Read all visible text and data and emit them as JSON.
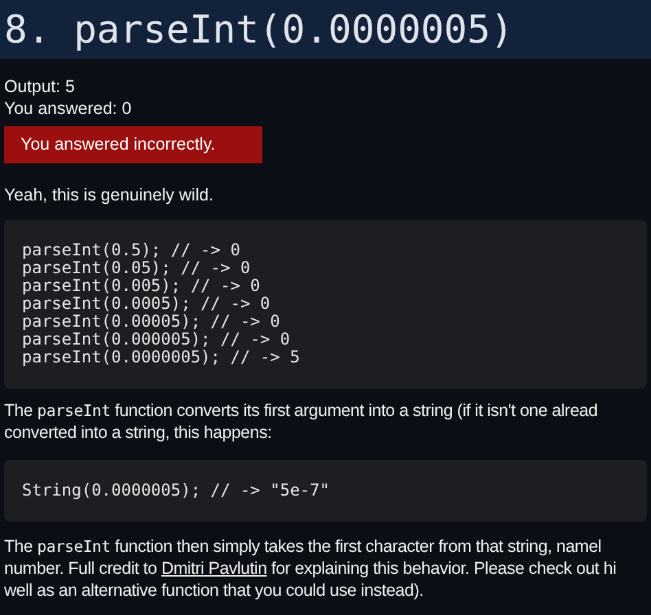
{
  "title": "8. parseInt(0.0000005)",
  "result": {
    "output": "Output: 5",
    "answered": "You answered: 0",
    "verdict": "You answered incorrectly.",
    "correct": false
  },
  "remark": "Yeah, this is genuinely wild.",
  "code_block_1": [
    "parseInt(0.5); // -> 0",
    "parseInt(0.05); // -> 0",
    "parseInt(0.005); // -> 0",
    "parseInt(0.0005); // -> 0",
    "parseInt(0.00005); // -> 0",
    "parseInt(0.000005); // -> 0",
    "parseInt(0.0000005); // -> 5"
  ],
  "paragraph_1": [
    [
      {
        "kind": "text",
        "text": "The "
      },
      {
        "kind": "code",
        "text": "parseInt"
      },
      {
        "kind": "text",
        "text": " function converts its first argument into a string (if it isn't one alread"
      }
    ],
    [
      {
        "kind": "text",
        "text": "converted into a string, this happens:"
      }
    ]
  ],
  "code_block_2": [
    "String(0.0000005); // -> \"5e-7\""
  ],
  "paragraph_2": [
    [
      {
        "kind": "text",
        "text": "The "
      },
      {
        "kind": "code",
        "text": "parseInt"
      },
      {
        "kind": "text",
        "text": " function then simply takes the first character from that string, namel"
      }
    ],
    [
      {
        "kind": "text",
        "text": "number. Full credit to "
      },
      {
        "kind": "link",
        "text": "Dmitri Pavlutin"
      },
      {
        "kind": "text",
        "text": " for explaining this behavior. Please check out hi"
      }
    ],
    [
      {
        "kind": "text",
        "text": "well as an alternative function that you could use instead)."
      }
    ]
  ]
}
